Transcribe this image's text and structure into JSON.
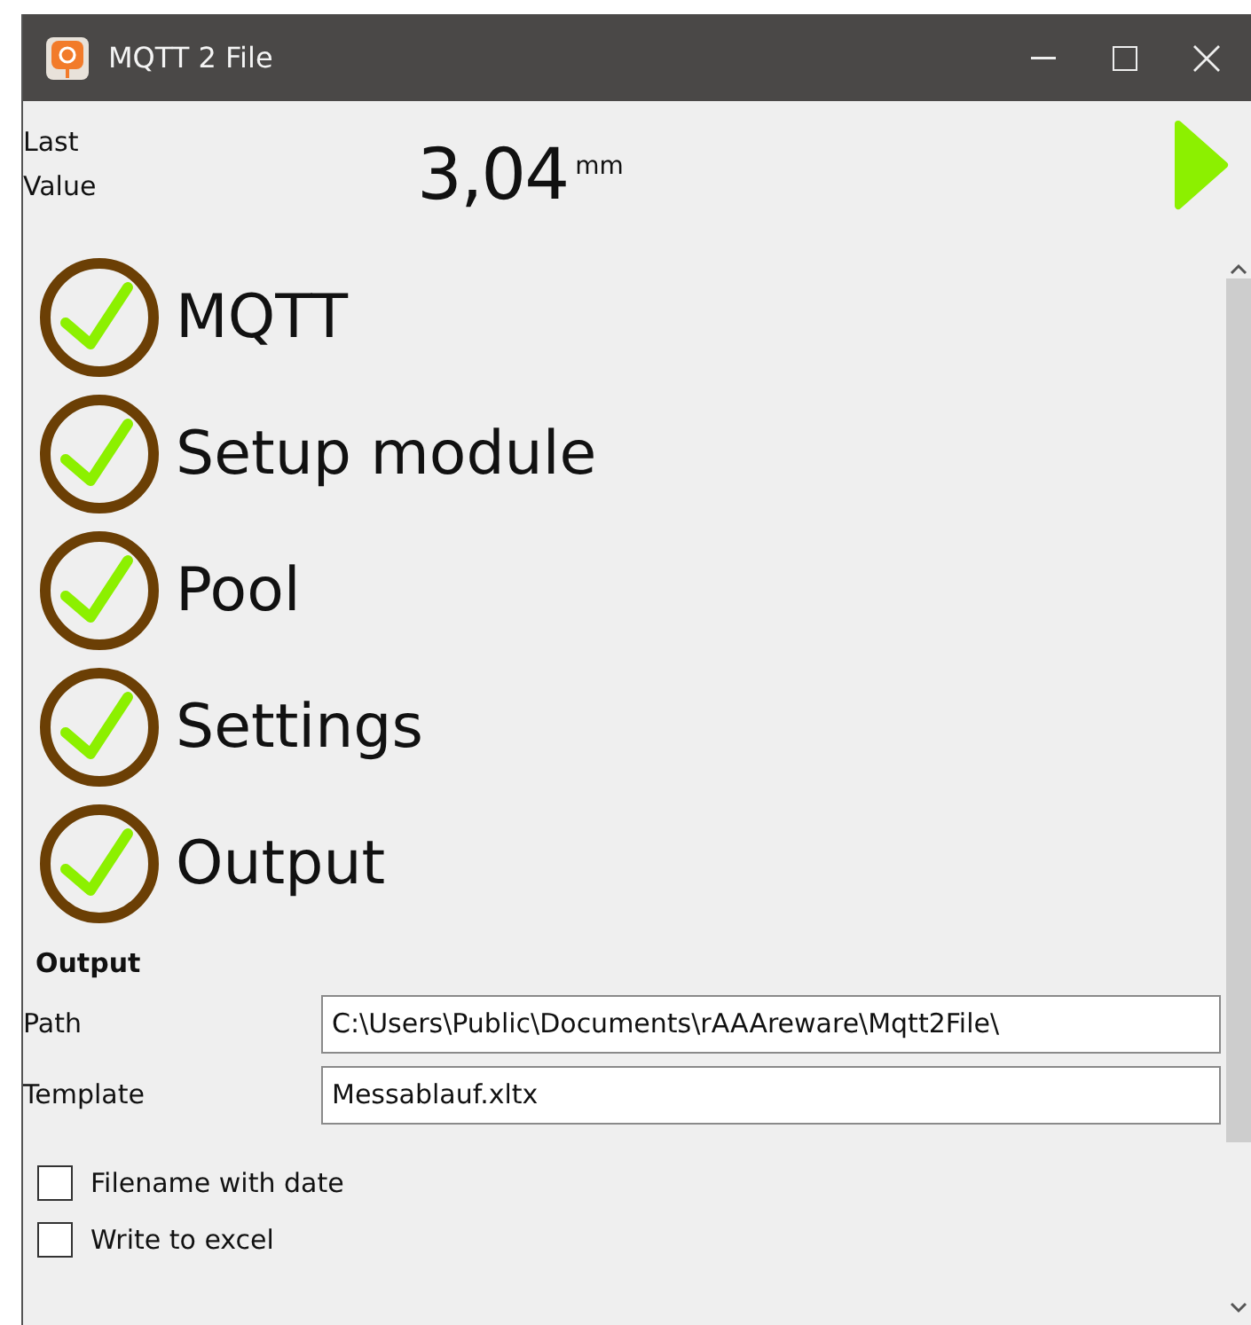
{
  "window": {
    "title": "MQTT 2 File"
  },
  "last_value": {
    "label_line_1": "Last",
    "label_line_2": "Value",
    "value": "3,04",
    "unit": "mm"
  },
  "steps": [
    {
      "label": "MQTT",
      "done": true
    },
    {
      "label": "Setup module",
      "done": true
    },
    {
      "label": "Pool",
      "done": true
    },
    {
      "label": "Settings",
      "done": true
    },
    {
      "label": "Output",
      "done": true
    }
  ],
  "output": {
    "heading": "Output",
    "fields": [
      {
        "label": "Path",
        "value": "C:\\Users\\Public\\Documents\\rAAAreware\\Mqtt2File\\"
      },
      {
        "label": "Template",
        "value": "Messablauf.xltx"
      }
    ],
    "options": [
      {
        "label": "Filename with date",
        "checked": false
      },
      {
        "label": "Write to excel",
        "checked": false
      }
    ]
  }
}
